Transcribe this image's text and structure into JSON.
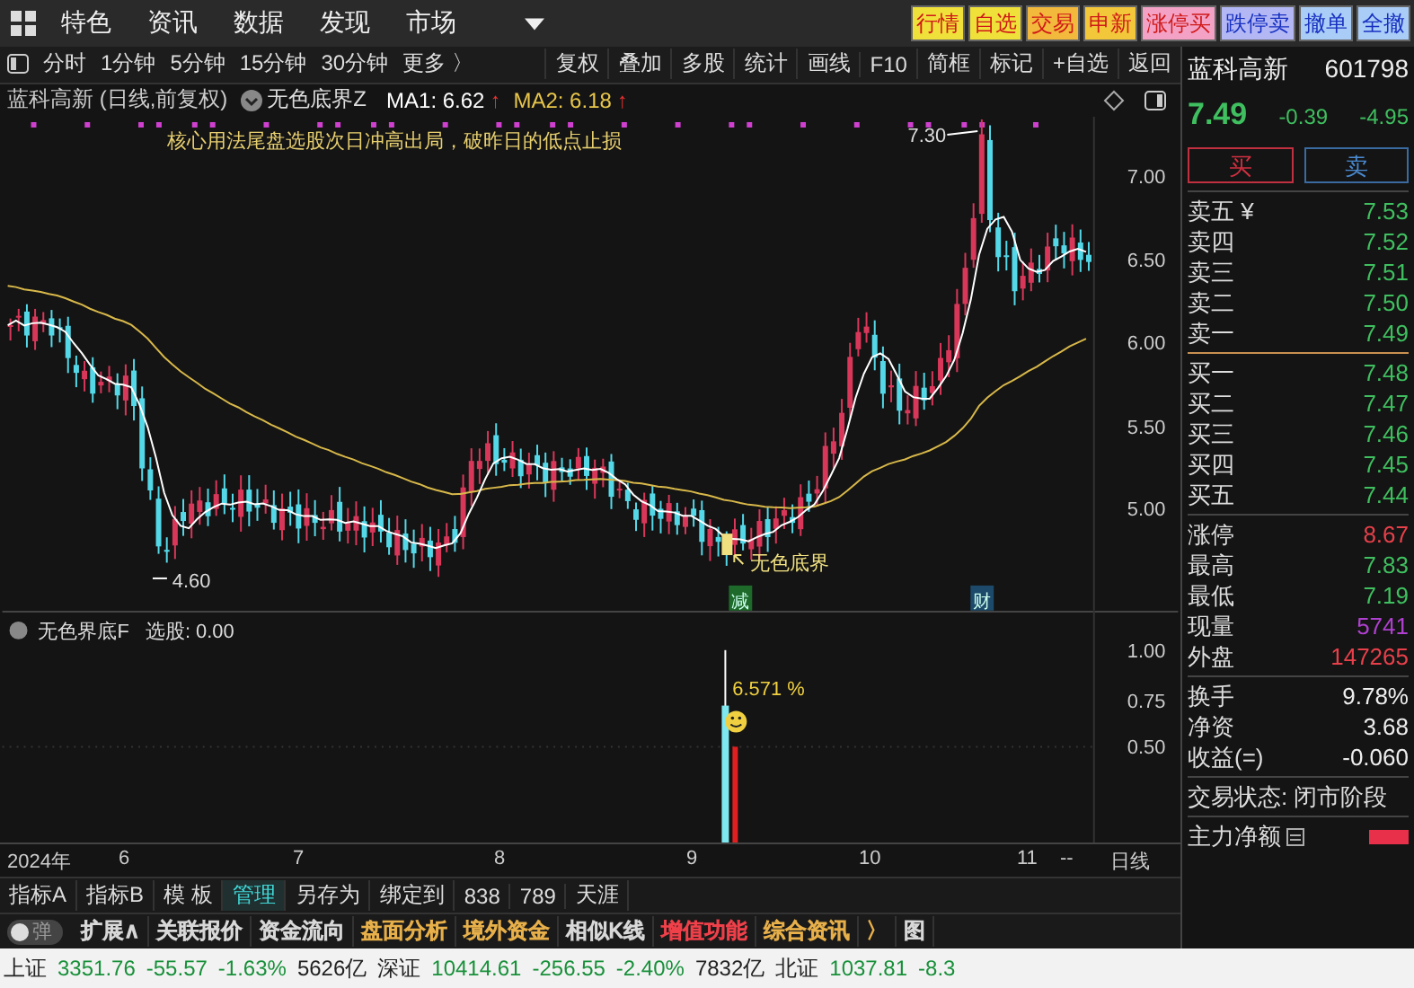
{
  "top_bar": {
    "menu": [
      "特色",
      "资讯",
      "数据",
      "发现",
      "市场"
    ],
    "quick_buttons": [
      {
        "label": "行情",
        "color": "#efe03a",
        "kind": "buy"
      },
      {
        "label": "自选",
        "color": "#efe03a",
        "kind": "buy"
      },
      {
        "label": "交易",
        "color": "#f2b93c",
        "kind": "buy"
      },
      {
        "label": "申新",
        "color": "#f2c83a",
        "kind": "buy"
      },
      {
        "label": "涨停买",
        "color": "#f3a2c6",
        "kind": "buy"
      },
      {
        "label": "跌停卖",
        "color": "#b3b8f5",
        "kind": "sell"
      },
      {
        "label": "撤单",
        "color": "#a9cdf7",
        "kind": "sell"
      },
      {
        "label": "全撤",
        "color": "#a9cdf7",
        "kind": "sell"
      }
    ]
  },
  "toolbar": {
    "periods": [
      "分时",
      "1分钟",
      "5分钟",
      "15分钟",
      "30分钟",
      "更多 〉"
    ],
    "tools": [
      "复权",
      "叠加",
      "多股",
      "统计",
      "画线",
      "F10",
      "简框",
      "标记",
      "+自选",
      "返回"
    ]
  },
  "chart": {
    "title": "蓝科高新 (日线,前复权)",
    "indicator": "无色底界Z",
    "ma": [
      {
        "label": "MA1: 6.62",
        "arrow": "↑",
        "color": "#ffffff"
      },
      {
        "label": "MA2: 6.18",
        "arrow": "↑",
        "color": "#e8c64a"
      }
    ],
    "note": "核心用法尾盘选股次日冲高出局，破昨日的低点止损",
    "high_label": "7.30",
    "low_label": "4.60",
    "signal_label": "无色底界",
    "markers": [
      "减",
      "财"
    ],
    "yticks": [
      "7.00",
      "6.50",
      "6.00",
      "5.50",
      "5.00"
    ]
  },
  "sub_chart": {
    "title": "无色界底F",
    "reading": "选股: 0.00",
    "value_label": "6.571 %",
    "yticks": [
      "1.00",
      "0.75",
      "0.50"
    ]
  },
  "x_axis": [
    "2024年",
    "6",
    "7",
    "8",
    "9",
    "10",
    "11",
    "--",
    "日线"
  ],
  "indicator_tabs": [
    {
      "label": "指标A",
      "selected": false
    },
    {
      "label": "指标B",
      "selected": false
    },
    {
      "label": "模 板",
      "selected": false
    },
    {
      "label": "管理",
      "selected": true
    },
    {
      "label": "另存为",
      "selected": false
    },
    {
      "label": "绑定到",
      "selected": false
    },
    {
      "label": "838",
      "selected": false
    },
    {
      "label": "789",
      "selected": false
    },
    {
      "label": "天涯",
      "selected": false
    }
  ],
  "feature_bar": {
    "toggle": {
      "label": "弹",
      "on": false
    },
    "items": [
      {
        "label": "扩展∧",
        "color": "#d8d8d8"
      },
      {
        "label": "关联报价",
        "color": "#d8d8d8"
      },
      {
        "label": "资金流向",
        "color": "#d8d8d8"
      },
      {
        "label": "盘面分析",
        "color": "#e8b04a"
      },
      {
        "label": "境外资金",
        "color": "#e8b04a"
      },
      {
        "label": "相似K线",
        "color": "#d8d8d8"
      },
      {
        "label": "增值功能",
        "color": "#f0404a"
      },
      {
        "label": "综合资讯",
        "color": "#e8b04a"
      },
      {
        "label": "〉",
        "color": "#e8b04a"
      },
      {
        "label": "图",
        "color": "#d8d8d8"
      }
    ]
  },
  "quote": {
    "name": "蓝科高新",
    "code": "601798",
    "price": "7.49",
    "change": "-0.39",
    "percent": "-4.95",
    "buy": "买",
    "sell": "卖",
    "asks": [
      {
        "label": "卖五 ¥",
        "price": "7.53"
      },
      {
        "label": "卖四",
        "price": "7.52"
      },
      {
        "label": "卖三",
        "price": "7.51"
      },
      {
        "label": "卖二",
        "price": "7.50"
      },
      {
        "label": "卖一",
        "price": "7.49"
      }
    ],
    "bids": [
      {
        "label": "买一",
        "price": "7.48"
      },
      {
        "label": "买二",
        "price": "7.47"
      },
      {
        "label": "买三",
        "price": "7.46"
      },
      {
        "label": "买四",
        "price": "7.45"
      },
      {
        "label": "买五",
        "price": "7.44"
      }
    ],
    "stats": [
      {
        "label": "涨停",
        "value": "8.67",
        "color": "#e8404a"
      },
      {
        "label": "最高",
        "value": "7.83",
        "color": "#3fbf5f"
      },
      {
        "label": "最低",
        "value": "7.19",
        "color": "#3fbf5f"
      },
      {
        "label": "现量",
        "value": "5741",
        "color": "#b040d0"
      },
      {
        "label": "外盘",
        "value": "147265",
        "color": "#e8404a"
      }
    ],
    "finance": [
      {
        "label": "换手",
        "value": "9.78%"
      },
      {
        "label": "净资",
        "value": "3.68"
      },
      {
        "label": "收益(=)",
        "value": "-0.060"
      }
    ],
    "status": "交易状态: 闭市阶段",
    "flow_label": "主力净额"
  },
  "status_bar": [
    {
      "name": "上证",
      "value": "3351.76",
      "change": "-55.57",
      "percent": "-1.63%",
      "amount": "5626亿"
    },
    {
      "name": "深证",
      "value": "10414.61",
      "change": "-256.55",
      "percent": "-2.40%",
      "amount": "7832亿"
    },
    {
      "name": "北证",
      "value": "1037.81",
      "change": "-8.3"
    }
  ]
}
